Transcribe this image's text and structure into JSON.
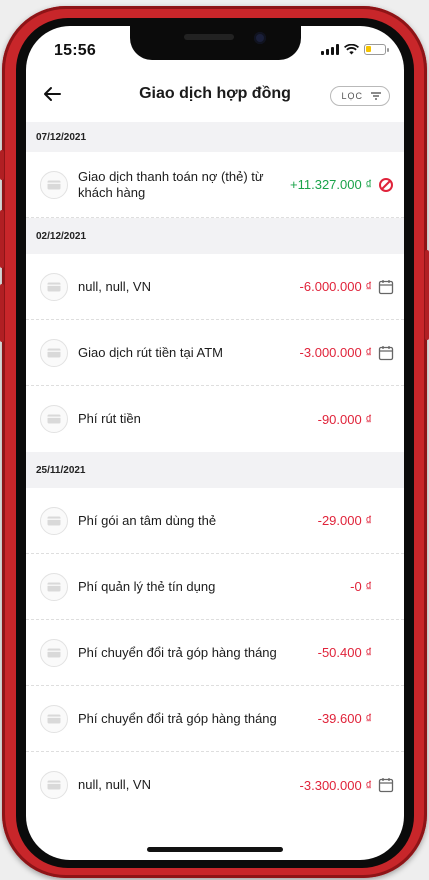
{
  "status_bar": {
    "time": "15:56"
  },
  "header": {
    "title": "Giao dịch hợp đồng",
    "filter_label": "LỌC"
  },
  "colors": {
    "negative": "#e0233a",
    "positive": "#1aa34a",
    "frame": "#c8262a"
  },
  "groups": [
    {
      "date": "07/12/2021",
      "items": [
        {
          "label": "Giao dịch thanh toán nợ (thẻ) từ khách hàng",
          "amount": "+11.327.000 ₫",
          "trail_icon": "cancel-icon"
        }
      ]
    },
    {
      "date": "02/12/2021",
      "items": [
        {
          "label": "null, null, VN",
          "amount": "-6.000.000 ₫",
          "trail_icon": "calendar-icon"
        },
        {
          "label": "Giao dịch rút tiền tại ATM",
          "amount": "-3.000.000 ₫",
          "trail_icon": "calendar-icon"
        },
        {
          "label": "Phí rút tiền",
          "amount": "-90.000 ₫",
          "trail_icon": ""
        }
      ]
    },
    {
      "date": "25/11/2021",
      "items": [
        {
          "label": "Phí gói an tâm dùng thẻ",
          "amount": "-29.000 ₫",
          "trail_icon": ""
        },
        {
          "label": "Phí quản lý thẻ tín dụng",
          "amount": "-0 ₫",
          "trail_icon": ""
        },
        {
          "label": "Phí chuyển đổi trả góp hàng tháng",
          "amount": "-50.400 ₫",
          "trail_icon": ""
        },
        {
          "label": "Phí chuyển đổi trả góp hàng tháng",
          "amount": "-39.600 ₫",
          "trail_icon": ""
        },
        {
          "label": "null, null, VN",
          "amount": "-3.300.000 ₫",
          "trail_icon": "calendar-icon"
        }
      ]
    }
  ]
}
